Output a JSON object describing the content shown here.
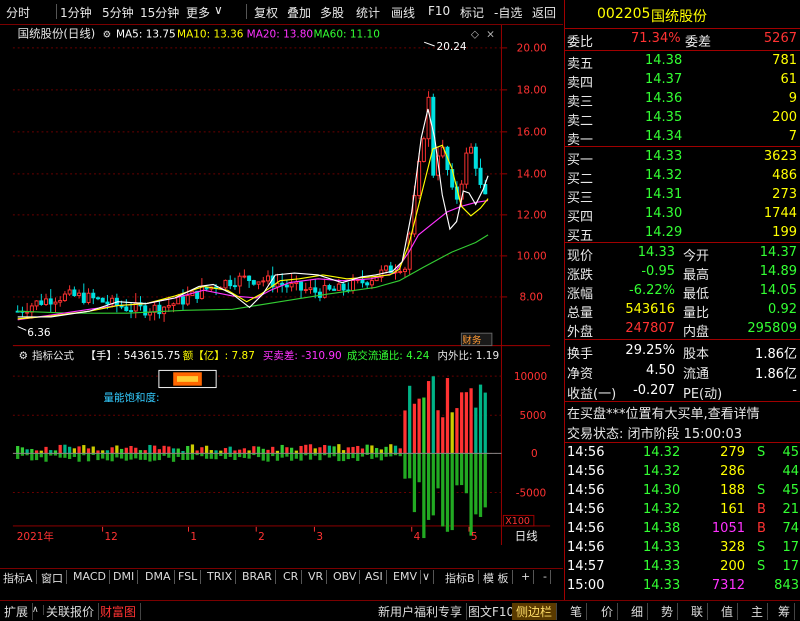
{
  "toolbar": {
    "items": [
      "分时",
      "1分钟",
      "5分钟",
      "15分钟",
      "更多",
      "复权",
      "叠加",
      "多股",
      "统计",
      "画线",
      "F10",
      "标记",
      "-自选",
      "返回"
    ]
  },
  "main_chart": {
    "title": "国统股份(日线)",
    "ma5": "MA5: 13.75",
    "ma10": "MA10: 13.36",
    "ma20": "MA20: 13.80",
    "ma60": "MA60: 11.10",
    "high_label": "20.24",
    "low_label": "6.36",
    "y_ticks": [
      "20.00",
      "18.00",
      "16.00",
      "14.00",
      "12.00",
      "10.00",
      "8.00"
    ],
    "badge": "财务"
  },
  "indicator": {
    "name": "指标公式",
    "hand": "【手】: 543615.75",
    "amount": "额【亿】: 7.87",
    "bs_diff": "买卖差: -310.90",
    "turnover_ratio": "成交流通比: 4.24",
    "io_ratio": "内外比: 1.19",
    "saturation_label": "量能饱和度:",
    "y_ticks": [
      "10000",
      "5000",
      "0",
      "-5000"
    ],
    "scale": "X100"
  },
  "time_axis": {
    "labels": [
      "2021年",
      "12",
      "1",
      "2",
      "3",
      "4",
      "5"
    ],
    "period": "日线"
  },
  "tabs1": [
    "指标A",
    "窗口",
    "MACD",
    "DMI",
    "DMA",
    "FSL",
    "TRIX",
    "BRAR",
    "CR",
    "VR",
    "OBV",
    "ASI",
    "EMV",
    "指标B",
    "模 板",
    "+",
    "-"
  ],
  "tabs2_left": [
    "扩展",
    "关联报价",
    "财富图"
  ],
  "tabs2_mid": [
    "新用户福利专享",
    "图文F10",
    "侧边栏"
  ],
  "tabs2_right": [
    "笔",
    "价",
    "细",
    "势",
    "联",
    "值",
    "主",
    "筹"
  ],
  "quote": {
    "code": "002205",
    "name": "国统股份",
    "weibi_label": "委比",
    "weibi": "71.34%",
    "weicha_label": "委差",
    "weicha": "5267",
    "sells": [
      {
        "label": "卖五",
        "price": "14.38",
        "vol": "781"
      },
      {
        "label": "卖四",
        "price": "14.37",
        "vol": "61"
      },
      {
        "label": "卖三",
        "price": "14.36",
        "vol": "9"
      },
      {
        "label": "卖二",
        "price": "14.35",
        "vol": "200"
      },
      {
        "label": "卖一",
        "price": "14.34",
        "vol": "7"
      }
    ],
    "buys": [
      {
        "label": "买一",
        "price": "14.33",
        "vol": "3623"
      },
      {
        "label": "买二",
        "price": "14.32",
        "vol": "486"
      },
      {
        "label": "买三",
        "price": "14.31",
        "vol": "273"
      },
      {
        "label": "买四",
        "price": "14.30",
        "vol": "1744"
      },
      {
        "label": "买五",
        "price": "14.29",
        "vol": "199"
      }
    ],
    "stats": [
      {
        "l1": "现价",
        "v1": "14.33",
        "l2": "今开",
        "v2": "14.37",
        "c1": "green",
        "c2": "green"
      },
      {
        "l1": "涨跌",
        "v1": "-0.95",
        "l2": "最高",
        "v2": "14.89",
        "c1": "green",
        "c2": "green"
      },
      {
        "l1": "涨幅",
        "v1": "-6.22%",
        "l2": "最低",
        "v2": "14.05",
        "c1": "green",
        "c2": "green"
      },
      {
        "l1": "总量",
        "v1": "543616",
        "l2": "量比",
        "v2": "0.92",
        "c1": "yellow",
        "c2": "green"
      },
      {
        "l1": "外盘",
        "v1": "247807",
        "l2": "内盘",
        "v2": "295809",
        "c1": "red",
        "c2": "green"
      }
    ],
    "stats2": [
      {
        "l1": "换手",
        "v1": "29.25%",
        "l2": "股本",
        "v2": "1.86亿"
      },
      {
        "l1": "净资",
        "v1": "4.50",
        "l2": "流通",
        "v2": "1.86亿"
      },
      {
        "l1": "收益(一)",
        "v1": "-0.207",
        "l2": "PE(动)",
        "v2": "-"
      }
    ],
    "notice": "在买盘***位置有大买单,查看详情",
    "status": "交易状态: 闭市阶段 15:00:03",
    "ticks": [
      {
        "t": "14:56",
        "p": "14.32",
        "v": "279",
        "f": "S",
        "n": "45",
        "vc": "yellow",
        "fc": "green"
      },
      {
        "t": "14:56",
        "p": "14.32",
        "v": "286",
        "f": "",
        "n": "44",
        "vc": "yellow",
        "fc": "green"
      },
      {
        "t": "14:56",
        "p": "14.30",
        "v": "188",
        "f": "S",
        "n": "45",
        "vc": "yellow",
        "fc": "green"
      },
      {
        "t": "14:56",
        "p": "14.32",
        "v": "161",
        "f": "B",
        "n": "21",
        "vc": "yellow",
        "fc": "red"
      },
      {
        "t": "14:56",
        "p": "14.38",
        "v": "1051",
        "f": "B",
        "n": "74",
        "vc": "magenta",
        "fc": "red"
      },
      {
        "t": "14:56",
        "p": "14.33",
        "v": "328",
        "f": "S",
        "n": "17",
        "vc": "yellow",
        "fc": "green"
      },
      {
        "t": "14:57",
        "p": "14.33",
        "v": "200",
        "f": "S",
        "n": "17",
        "vc": "yellow",
        "fc": "green"
      },
      {
        "t": "15:00",
        "p": "14.33",
        "v": "7312",
        "f": "",
        "n": "843",
        "vc": "magenta",
        "fc": "green"
      }
    ]
  }
}
